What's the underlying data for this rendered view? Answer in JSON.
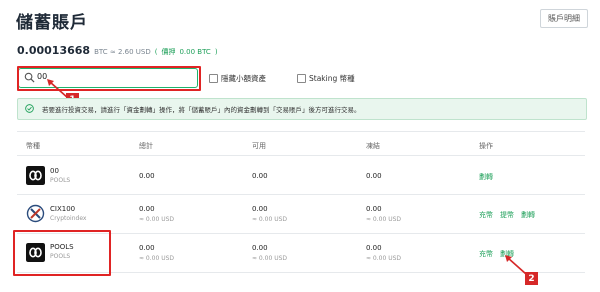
{
  "page": {
    "title": "儲蓄賬戶",
    "account_button": "賬戶明細"
  },
  "balance": {
    "amount": "0.00013668",
    "unit_and_usd": "BTC ≈ 2.60 USD",
    "locked_prefix": "(",
    "locked_label": "價押",
    "locked_value": "0.00 BTC",
    "locked_suffix": ")"
  },
  "search": {
    "value": "00",
    "hide_small_label": "隱藏小額資產",
    "staking_label": "Staking 幣種"
  },
  "notice": {
    "text": "若要進行投資交易，請進行「資金劃轉」操作，將「儲蓄賬戶」內的資金劃轉到「交易賬戶」後方可進行交易。"
  },
  "table": {
    "headers": [
      "幣種",
      "總計",
      "可用",
      "凍結",
      "操作"
    ],
    "rows": [
      {
        "code": "00",
        "name": "POOLS",
        "total": "0.00",
        "available": "0.00",
        "frozen": "0.00",
        "actions": [
          "劃轉"
        ]
      },
      {
        "code": "CIX100",
        "name": "Cryptoindex",
        "total": "0.00",
        "total_usd": "≈ 0.00 USD",
        "available": "0.00",
        "available_usd": "≈ 0.00 USD",
        "frozen": "0.00",
        "frozen_usd": "≈ 0.00 USD",
        "actions": [
          "充幣",
          "提幣",
          "劃轉"
        ]
      },
      {
        "code": "POOLS",
        "name": "POOLS",
        "total": "0.00",
        "total_usd": "≈ 0.00 USD",
        "available": "0.00",
        "available_usd": "≈ 0.00 USD",
        "frozen": "0.00",
        "frozen_usd": "≈ 0.00 USD",
        "actions": [
          "充幣",
          "劃轉"
        ]
      }
    ]
  },
  "annotations": {
    "badge1": "1",
    "badge2": "2"
  },
  "colors": {
    "accent": "#1fa05a",
    "annotation": "#d62828"
  }
}
